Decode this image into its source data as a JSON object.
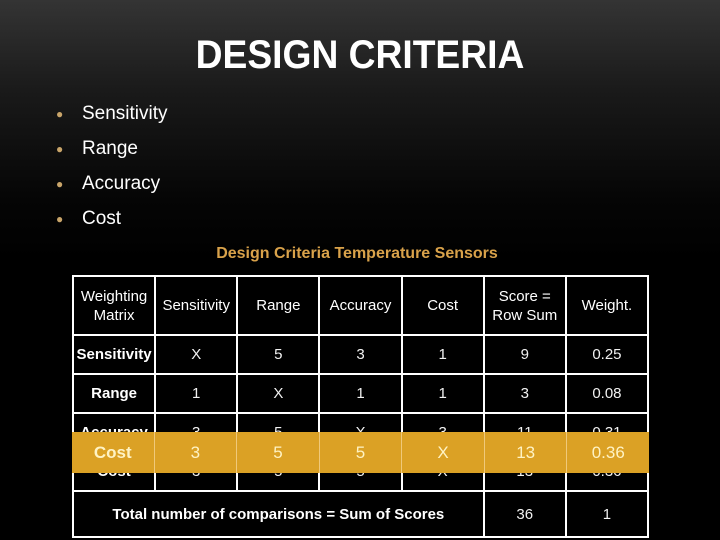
{
  "slide": {
    "title": "DESIGN CRITERIA",
    "bullets": [
      "Sensitivity",
      "Range",
      "Accuracy",
      "Cost"
    ],
    "bullet_color": "#c9a56a"
  },
  "table": {
    "caption": "Design Criteria Temperature Sensors",
    "caption_color": "#d9a24a",
    "headers": [
      "Weighting Matrix",
      "Sensitivity",
      "Range",
      "Accuracy",
      "Cost",
      "Score = Row Sum",
      "Weight."
    ],
    "rows": [
      {
        "label": "Sensitivity",
        "cells": [
          "X",
          "5",
          "3",
          "1",
          "9",
          "0.25"
        ]
      },
      {
        "label": "Range",
        "cells": [
          "1",
          "X",
          "1",
          "1",
          "3",
          "0.08"
        ]
      },
      {
        "label": "Accuracy",
        "cells": [
          "3",
          "5",
          "X",
          "3",
          "11",
          "0.31"
        ]
      },
      {
        "label": "Cost",
        "cells": [
          "3",
          "5",
          "5",
          "X",
          "13",
          "0.36"
        ]
      }
    ],
    "total": {
      "label": "Total number of comparisons = Sum of Scores",
      "score": "36",
      "weight": "1"
    }
  },
  "highlight": {
    "color": "#dba125",
    "text_color": "#fff3c4",
    "label": "Cost",
    "cells": [
      "3",
      "5",
      "5",
      "X",
      "13",
      "0.36"
    ]
  }
}
